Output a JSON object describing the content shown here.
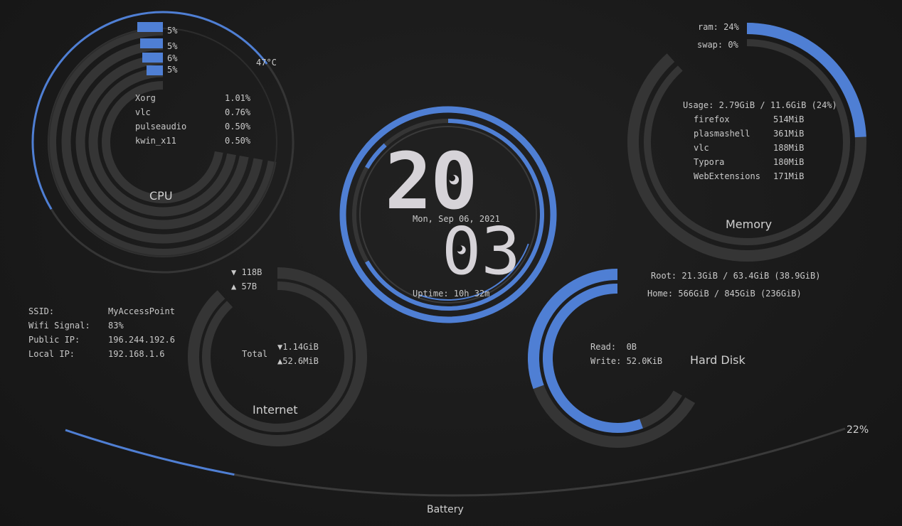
{
  "cpu": {
    "label": "CPU",
    "temp": "47°C",
    "cores": [
      {
        "value": "5%",
        "pct": 5
      },
      {
        "value": "5%",
        "pct": 5
      },
      {
        "value": "6%",
        "pct": 6
      },
      {
        "value": "5%",
        "pct": 5
      }
    ],
    "processes": [
      {
        "name": "Xorg",
        "value": "1.01%"
      },
      {
        "name": "vlc",
        "value": "0.76%"
      },
      {
        "name": "pulseaudio",
        "value": "0.50%"
      },
      {
        "name": "kwin_x11",
        "value": "0.50%"
      }
    ]
  },
  "clock": {
    "hour": "20",
    "minute": "03",
    "date": "Mon, Sep 06, 2021",
    "uptime": "Uptime: 10h 32m"
  },
  "memory": {
    "label": "Memory",
    "ram": "ram: 24%",
    "ram_pct": 24,
    "swap": "swap: 0%",
    "swap_pct": 0,
    "usage": "Usage: 2.79GiB / 11.6GiB (24%)",
    "processes": [
      {
        "name": "firefox",
        "value": "514MiB"
      },
      {
        "name": "plasmashell",
        "value": "361MiB"
      },
      {
        "name": "vlc",
        "value": "188MiB"
      },
      {
        "name": "Typora",
        "value": "180MiB"
      },
      {
        "name": "WebExtensions",
        "value": "171MiB"
      }
    ]
  },
  "internet": {
    "label": "Internet",
    "down_rate": "▼ 118B",
    "up_rate": "▲ 57B",
    "total_label": "Total",
    "total_down": "▼1.14GiB",
    "total_up": "▲52.6MiB"
  },
  "wifi": {
    "ssid_label": "SSID:",
    "ssid": "MyAccessPoint",
    "signal_label": "Wifi Signal:",
    "signal": "83%",
    "public_ip_label": "Public IP:",
    "public_ip": "196.244.192.6",
    "local_ip_label": "Local IP:",
    "local_ip": "192.168.1.6"
  },
  "disk": {
    "label": "Hard Disk",
    "root": "Root: 21.3GiB / 63.4GiB (38.9GiB)",
    "root_pct": 33.6,
    "home": "Home: 566GiB / 845GiB (236GiB)",
    "home_pct": 67,
    "read": "Read:  0B",
    "write": "Write: 52.0KiB"
  },
  "battery": {
    "label": "Battery",
    "value": "22%",
    "pct": 22
  },
  "colors": {
    "accent": "#4f7fd4",
    "track": "#353535",
    "text": "#c9c9c9"
  }
}
